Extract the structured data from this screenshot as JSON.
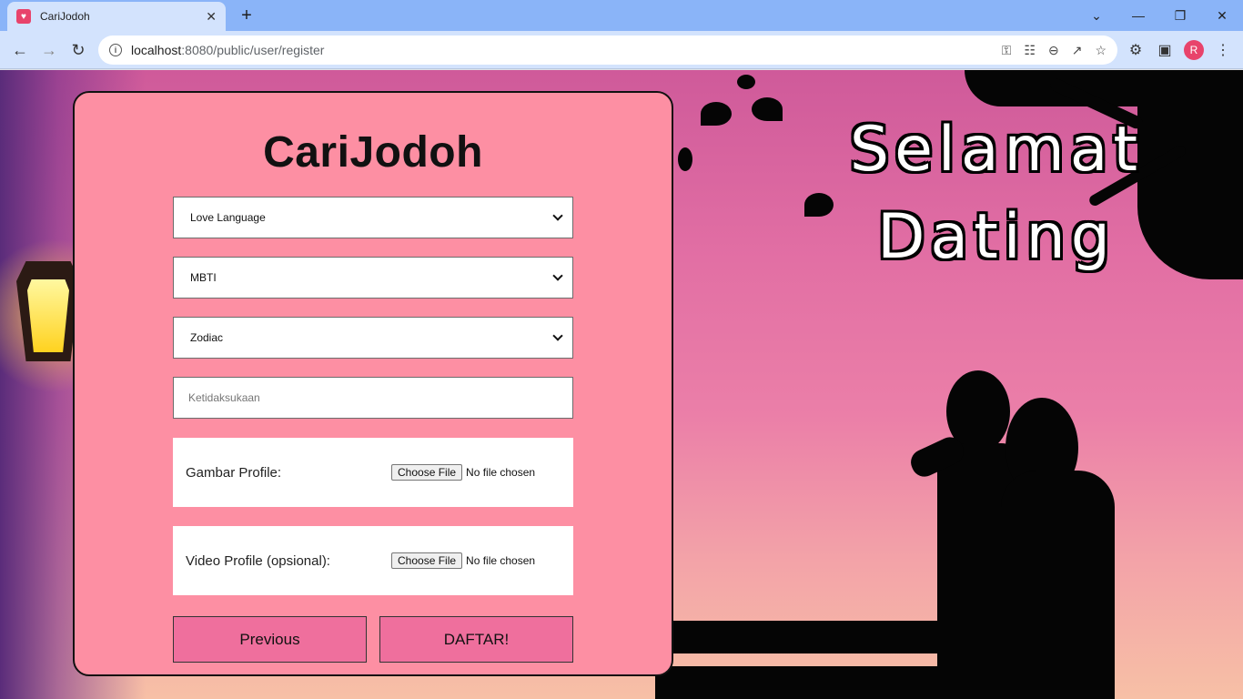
{
  "browser": {
    "tab_title": "CariJodoh",
    "url_host": "localhost",
    "url_path": ":8080/public/user/register",
    "profile_initial": "R"
  },
  "form": {
    "brand": "CariJodoh",
    "love_language": "Love Language",
    "mbti": "MBTI",
    "zodiac": "Zodiac",
    "dislikes_placeholder": "Ketidaksukaan",
    "profile_image_label": "Gambar Profile:",
    "profile_video_label": "Video Profile (opsional):",
    "choose_file_label": "Choose File",
    "no_file_text": "No file chosen",
    "previous_label": "Previous",
    "submit_label": "DAFTAR!"
  },
  "hero": {
    "line1": "Selamat",
    "line2": "Dating"
  },
  "colors": {
    "card": "#fd8fa3",
    "button": "#ef6f9d",
    "tab_strip": "#8ab4f8"
  }
}
